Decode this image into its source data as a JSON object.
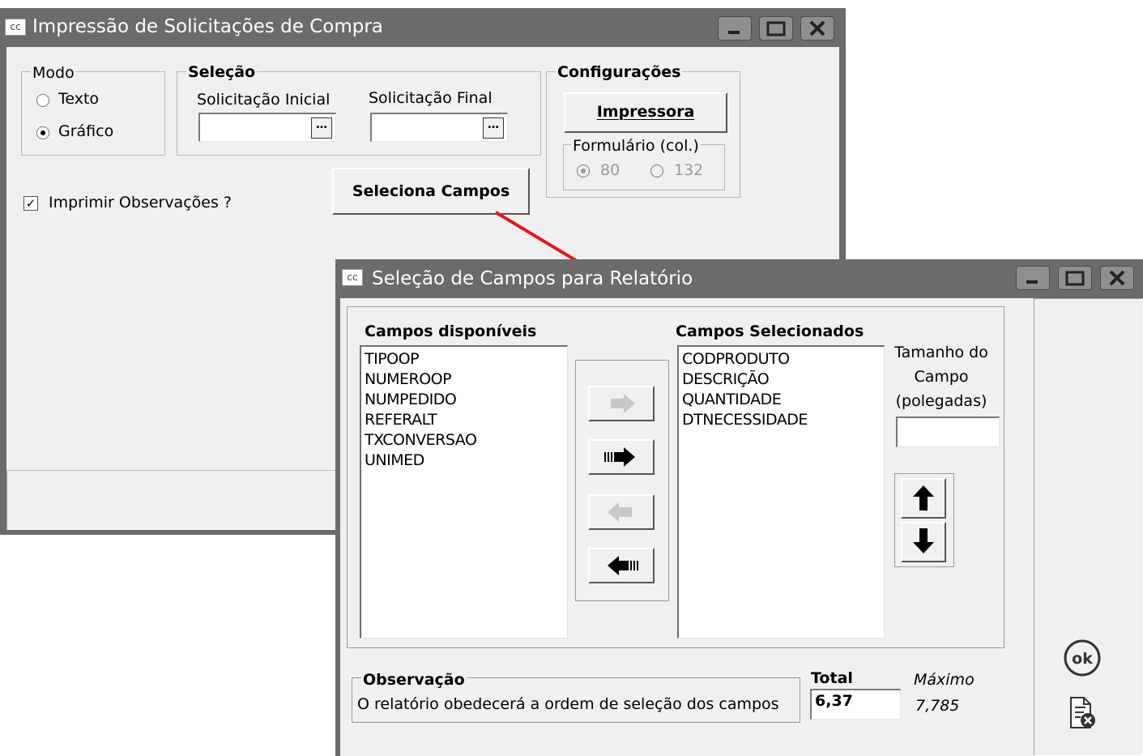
{
  "window1": {
    "icon": "cc",
    "title": "Impressão de Solicitações de Compra",
    "controls": [
      "minimize-icon",
      "maximize-icon",
      "close-icon"
    ],
    "modo": {
      "label": "Modo",
      "options": [
        {
          "label": "Texto",
          "selected": false
        },
        {
          "label": "Gráfico",
          "selected": true
        }
      ]
    },
    "selecao": {
      "label": "Seleção",
      "inicial_label": "Solicitação Inicial",
      "inicial_value": "",
      "final_label": "Solicitação Final",
      "final_value": "",
      "lookup_glyph": "…"
    },
    "config": {
      "label": "Configurações",
      "printer_button": "Impressora",
      "form_label": "Formulário (col.)",
      "form_options": [
        {
          "label": "80",
          "selected": true
        },
        {
          "label": "132",
          "selected": false
        }
      ]
    },
    "select_fields_button": "Seleciona Campos",
    "print_obs": {
      "label": "Imprimir  Observações ?",
      "checked": true
    }
  },
  "window2": {
    "icon": "cc",
    "title": "Seleção de Campos para Relatório",
    "controls": [
      "minimize-icon",
      "maximize-icon",
      "close-icon"
    ],
    "available_label": "Campos disponíveis",
    "available": [
      "TIPOOP",
      "NUMEROOP",
      "NUMPEDIDO",
      "REFERALT",
      "TXCONVERSAO",
      "UNIMED"
    ],
    "selected_label": "Campos Selecionados",
    "selected": [
      "CODPRODUTO",
      "DESCRIÇÃO",
      "QUANTIDADE",
      "DTNECESSIDADE"
    ],
    "size_label_1": "Tamanho do",
    "size_label_2": "Campo",
    "size_label_3": "(polegadas)",
    "size_value": "",
    "obs_label": "Observação",
    "obs_text": "O relatório obedecerá a ordem de seleção dos campos",
    "total_label": "Total",
    "total_value": "6,37",
    "max_label": "Máximo",
    "max_value": "7,785",
    "ok_glyph": "ok",
    "icons": [
      "move-right-icon",
      "move-all-right-icon",
      "move-left-icon",
      "move-all-left-icon",
      "move-up-icon",
      "move-down-icon",
      "ok-icon",
      "cancel-document-icon"
    ]
  },
  "colors": {
    "titlebar": "#6b6b6b",
    "face": "#f0f0f0",
    "arrow": "#e8141b"
  }
}
